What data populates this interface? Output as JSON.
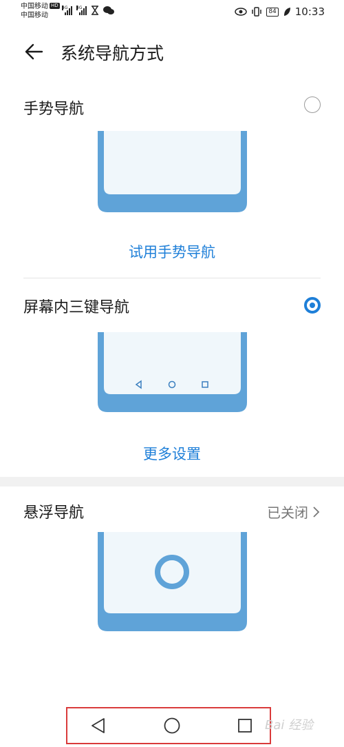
{
  "status_bar": {
    "carrier1": "中国移动",
    "carrier1_badge": "HD",
    "carrier2": "中国移动",
    "net1": "4G",
    "net2": "4G",
    "battery": "84",
    "time": "10:33"
  },
  "header": {
    "title": "系统导航方式"
  },
  "options": [
    {
      "label": "手势导航",
      "selected": false,
      "action": "试用手势导航"
    },
    {
      "label": "屏幕内三键导航",
      "selected": true,
      "action": "更多设置"
    },
    {
      "label": "悬浮导航",
      "status": "已关闭"
    }
  ],
  "colors": {
    "accent": "#1e7fd8",
    "phone_frame": "#5fa3d8",
    "phone_screen": "#f0f7fb"
  },
  "system_nav": {
    "icons": [
      "back-triangle-icon",
      "home-circle-icon",
      "recents-square-icon"
    ]
  },
  "watermark": "Bai 经验"
}
